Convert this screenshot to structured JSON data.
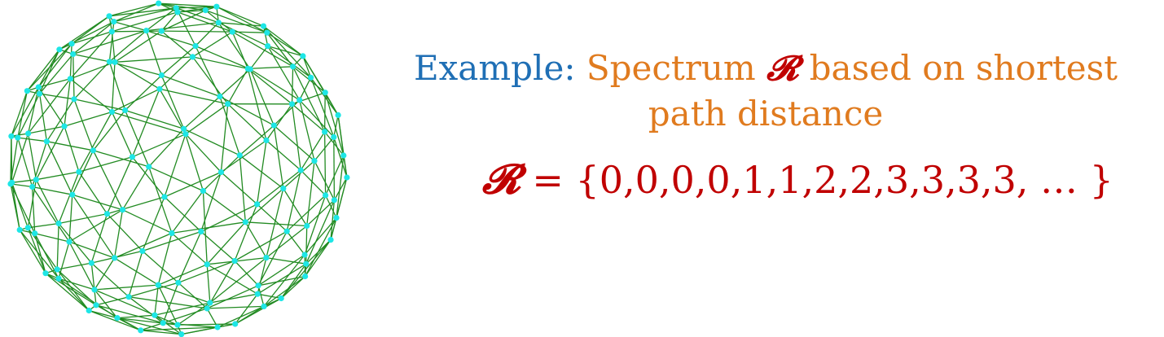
{
  "caption": {
    "prefix": "Example:",
    "main": "Spectrum",
    "symbol": "𝓡",
    "rest": "based on shortest",
    "line2": "path distance"
  },
  "formula": {
    "symbol": "𝓡",
    "expression": " = {0,0,0,0,1,1,2,2,3,3,3,3, … }"
  },
  "colors": {
    "edge": "#228b22",
    "node": "#1ee6e6",
    "prefix": "#1f6fb5",
    "caption": "#e07b1f",
    "formula": "#c00000"
  }
}
